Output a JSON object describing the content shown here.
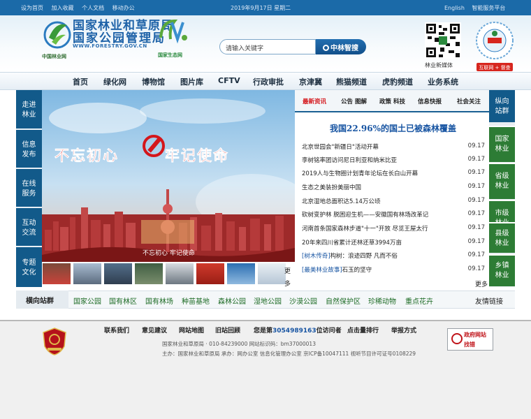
{
  "topbar": {
    "left_links": [
      "设为首页",
      "加入收藏",
      "个人文档",
      "移动办公"
    ],
    "date": "2019年9月17日 星期二",
    "right_links": [
      "English",
      "智能服务平台"
    ]
  },
  "header": {
    "logo_line1": "国家林业和草原局",
    "logo_line2": "国家公园管理局",
    "logo_url": "WWW.FORESTRY.GOV.CN",
    "logo_caption": "中国林业网",
    "park_name": "国家生态网",
    "search_placeholder": "请输入关键字",
    "search_button": "中林智搜",
    "qr_label": "林业新媒体",
    "badge_label": "互联网 + 督查"
  },
  "nav": [
    "首页",
    "绿化网",
    "博物馆",
    "图片库",
    "CFTV",
    "行政审批",
    "京津冀",
    "熊猫频道",
    "虎豹频道",
    "业务系统"
  ],
  "left_menu": [
    [
      "走进",
      "林业"
    ],
    [
      "信息",
      "发布"
    ],
    [
      "在线",
      "服务"
    ],
    [
      "互动",
      "交流"
    ],
    [
      "专题",
      "文化"
    ]
  ],
  "banner": {
    "slogan_left": "不忘初心",
    "slogan_right": "牢记使命",
    "caption": "不忘初心  牢记使命",
    "more": "更多"
  },
  "news": {
    "tabs": [
      "最新资讯",
      "公告 图解",
      "政策 科技",
      "信息快报",
      "社会关注"
    ],
    "headline": "我国22.96%的国土已被森林覆盖",
    "items": [
      {
        "prefix": "",
        "title": "北京世园会\"新疆日\"活动开幕",
        "date": "09.17"
      },
      {
        "prefix": "",
        "title": "李树铭率团访问尼日利亚和纳米比亚",
        "date": "09.17"
      },
      {
        "prefix": "",
        "title": "2019人与生物圈计划青年论坛在长白山开幕",
        "date": "09.17"
      },
      {
        "prefix": "",
        "title": "生态之美装扮美丽中国",
        "date": "09.17"
      },
      {
        "prefix": "",
        "title": "北京湿地总面积达5.14万公顷",
        "date": "09.17"
      },
      {
        "prefix": "",
        "title": "砍树变护林  脱困迎生机——安徽国有林场改革记",
        "date": "09.17"
      },
      {
        "prefix": "",
        "title": "河南首条国家森林步道\"十一\"开放  尽览王屋太行",
        "date": "09.17"
      },
      {
        "prefix": "",
        "title": "20年来四川省累计还林还草3994万亩",
        "date": "09.17"
      },
      {
        "prefix": "[树木传奇]",
        "title": "构树：浪迹四野  凡而不俗",
        "date": "09.17"
      },
      {
        "prefix": "[最美林业故事]",
        "title": "石玉的坚守",
        "date": "09.17"
      }
    ],
    "more": "更多"
  },
  "right_group": {
    "head": [
      "纵向",
      "站群"
    ],
    "items": [
      [
        "国家",
        "林业"
      ],
      [
        "省级",
        "林业"
      ],
      [
        "市级",
        "林业"
      ],
      [
        "县级",
        "林业"
      ],
      [
        "乡镇",
        "林业"
      ]
    ]
  },
  "h_group": {
    "label": "横向站群",
    "items": [
      "国家公园",
      "国有林区",
      "国有林场",
      "种苗基地",
      "森林公园",
      "湿地公园",
      "沙漠公园",
      "自然保护区",
      "珍稀动物",
      "重点花卉"
    ],
    "friend_link": "友情链接"
  },
  "footer": {
    "links": [
      "联系我们",
      "意见建议",
      "网站地图",
      "旧站回顾"
    ],
    "count_prefix": "您是第",
    "count_number": "3054989163",
    "count_suffix": "位访问者",
    "links2": [
      "点击量排行",
      "举报方式"
    ],
    "line1": "国家林业和草原局 · 010-84239000 网站标识码：bm37000013",
    "line2": "主办：国家林业和草原局 承办：网办公室 信息化管理办公室 京ICP备10047111 视听节目许可证号0108229",
    "gov_line1": "政府网站",
    "gov_line2": "找错"
  },
  "colors": {
    "topbar": "#1b6aa8",
    "menu_blue": "#125a8a",
    "site_green": "#2d7c35",
    "accent_red": "#d4161b",
    "headline_blue": "#1754a2"
  }
}
